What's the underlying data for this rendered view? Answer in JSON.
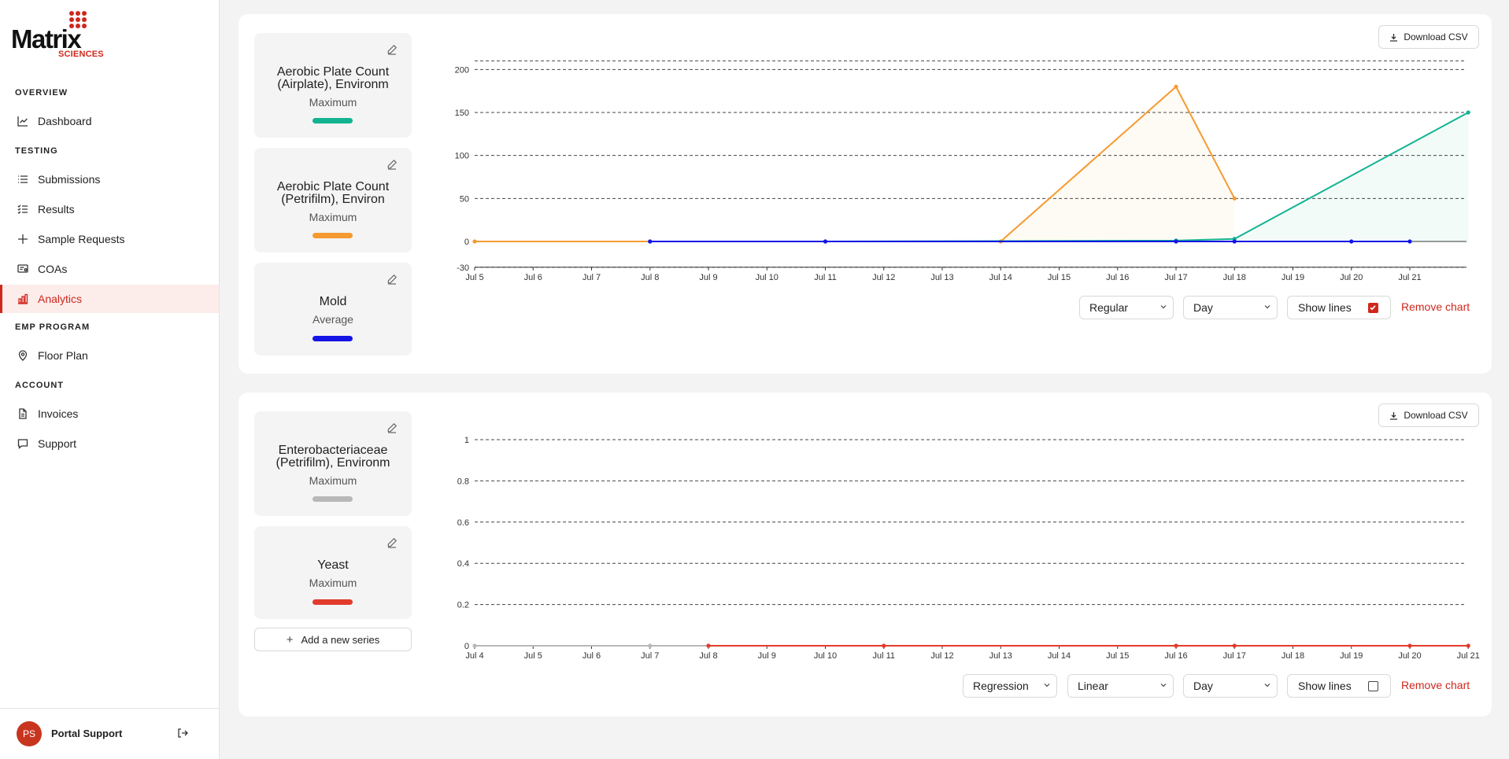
{
  "brand": {
    "word": "Matrix",
    "sub": "SCIENCES",
    "color": "#d0271d"
  },
  "sidebar": {
    "sections": [
      {
        "label": "OVERVIEW",
        "items": [
          {
            "label": "Dashboard",
            "icon": "chart-line-icon"
          }
        ]
      },
      {
        "label": "TESTING",
        "items": [
          {
            "label": "Submissions",
            "icon": "list-icon"
          },
          {
            "label": "Results",
            "icon": "checklist-icon"
          },
          {
            "label": "Sample Requests",
            "icon": "plus-icon"
          },
          {
            "label": "COAs",
            "icon": "certificate-icon"
          },
          {
            "label": "Analytics",
            "icon": "bar-chart-icon",
            "active": true
          }
        ]
      },
      {
        "label": "EMP PROGRAM",
        "items": [
          {
            "label": "Floor Plan",
            "icon": "map-pin-icon"
          }
        ]
      },
      {
        "label": "ACCOUNT",
        "items": [
          {
            "label": "Invoices",
            "icon": "document-icon"
          },
          {
            "label": "Support",
            "icon": "message-icon"
          }
        ]
      }
    ],
    "user": {
      "initials": "PS",
      "name": "Portal Support"
    }
  },
  "charts": [
    {
      "download_label": "Download CSV",
      "series_cards": [
        {
          "title": "Aerobic Plate Count (Airplate), Environm",
          "agg": "Maximum",
          "color": "#12b391"
        },
        {
          "title": "Aerobic Plate Count (Petrifilm), Environ",
          "agg": "Maximum",
          "color": "#f59a30"
        },
        {
          "title": "Mold",
          "agg": "Average",
          "color": "#1414e6"
        }
      ],
      "controls": {
        "mode": "Regular",
        "interval": "Day",
        "show_lines_label": "Show lines",
        "show_lines": true,
        "remove_label": "Remove chart"
      }
    },
    {
      "download_label": "Download CSV",
      "series_cards": [
        {
          "title": "Enterobacteriaceae (Petrifilm), Environm",
          "agg": "Maximum",
          "color": "#b8b8b8"
        },
        {
          "title": "Yeast",
          "agg": "Maximum",
          "color": "#e23b2c"
        }
      ],
      "add_series_label": "Add a new series",
      "controls": {
        "mode": "Regression",
        "fit": "Linear",
        "interval": "Day",
        "show_lines_label": "Show lines",
        "show_lines": false,
        "remove_label": "Remove chart"
      }
    }
  ],
  "chart_data": [
    {
      "type": "line",
      "x": [
        "Jul 5",
        "Jul 6",
        "Jul 7",
        "Jul 8",
        "Jul 9",
        "Jul 10",
        "Jul 11",
        "Jul 12",
        "Jul 13",
        "Jul 14",
        "Jul 15",
        "Jul 16",
        "Jul 17",
        "Jul 18",
        "Jul 19",
        "Jul 20",
        "Jul 21"
      ],
      "yticks": [
        -30,
        0,
        50,
        100,
        150,
        200
      ],
      "ylim": [
        -30,
        210
      ],
      "grid": true,
      "series": [
        {
          "color": "#f59a30",
          "fill": true,
          "points": [
            [
              "Jul 5",
              0
            ],
            [
              "Jul 14",
              0
            ],
            [
              "Jul 17",
              180
            ],
            [
              "Jul 18",
              50
            ]
          ]
        },
        {
          "color": "#12b391",
          "fill": true,
          "points": [
            [
              "Jul 8",
              0
            ],
            [
              "Jul 11",
              0
            ],
            [
              "Jul 17",
              1
            ],
            [
              "Jul 18",
              3
            ],
            [
              "Jul 22",
              150
            ]
          ]
        },
        {
          "color": "#1414e6",
          "fill": false,
          "points": [
            [
              "Jul 8",
              0
            ],
            [
              "Jul 11",
              0
            ],
            [
              "Jul 17",
              0
            ],
            [
              "Jul 18",
              0
            ],
            [
              "Jul 20",
              0
            ],
            [
              "Jul 21",
              0
            ]
          ]
        }
      ]
    },
    {
      "type": "line",
      "x": [
        "Jul 4",
        "Jul 5",
        "Jul 6",
        "Jul 7",
        "Jul 8",
        "Jul 9",
        "Jul 10",
        "Jul 11",
        "Jul 12",
        "Jul 13",
        "Jul 14",
        "Jul 15",
        "Jul 16",
        "Jul 17",
        "Jul 18",
        "Jul 19",
        "Jul 20",
        "Jul 21"
      ],
      "yticks": [
        0,
        0.2,
        0.4,
        0.6,
        0.8,
        1
      ],
      "ylim": [
        0,
        1
      ],
      "grid": true,
      "series": [
        {
          "color": "#b8b8b8",
          "fill": false,
          "points": [
            [
              "Jul 4",
              0
            ],
            [
              "Jul 7",
              0
            ],
            [
              "Jul 8",
              0
            ]
          ]
        },
        {
          "color": "#e23b2c",
          "fill": false,
          "points": [
            [
              "Jul 8",
              0
            ],
            [
              "Jul 11",
              0
            ],
            [
              "Jul 16",
              0
            ],
            [
              "Jul 17",
              0
            ],
            [
              "Jul 20",
              0
            ],
            [
              "Jul 21",
              0
            ]
          ]
        }
      ]
    }
  ]
}
